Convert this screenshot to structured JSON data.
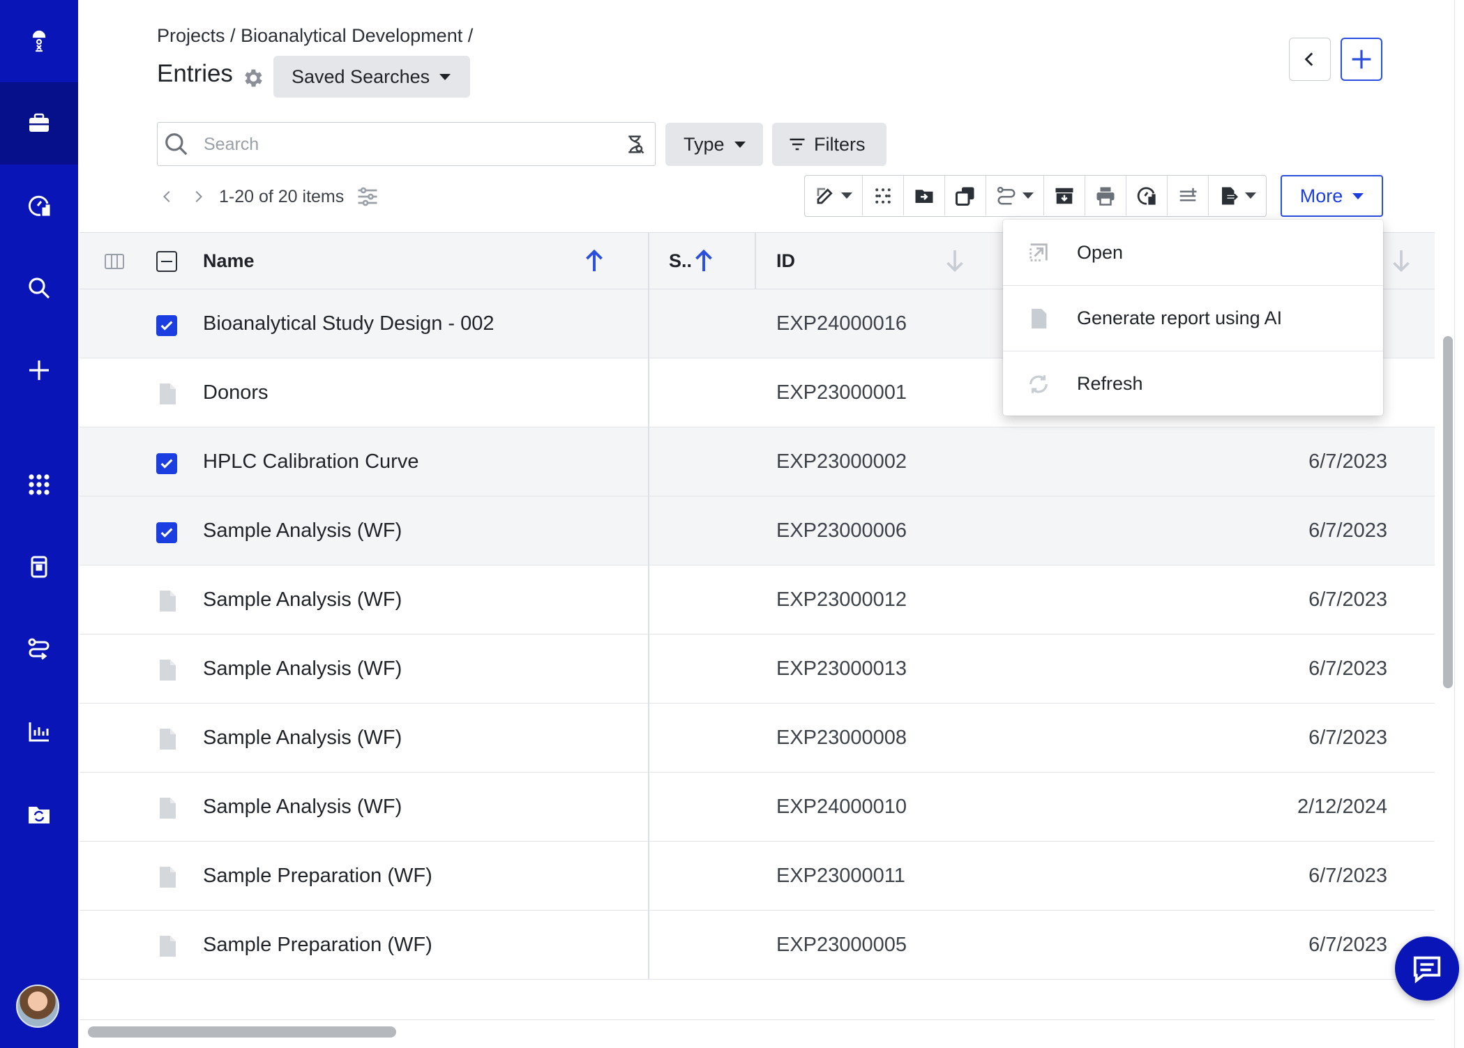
{
  "sidebar": {
    "items": [
      {
        "name": "logo-icon"
      },
      {
        "name": "projects-briefcase-icon"
      },
      {
        "name": "dashboard-gauge-icon"
      },
      {
        "name": "search-icon"
      },
      {
        "name": "create-plus-icon"
      },
      {
        "name": "apps-grid-icon"
      },
      {
        "name": "inventory-icon"
      },
      {
        "name": "workflows-icon"
      },
      {
        "name": "reports-chart-icon"
      },
      {
        "name": "sync-folder-icon"
      }
    ]
  },
  "header": {
    "breadcrumb": "Projects / Bioanalytical Development /",
    "title": "Entries",
    "saved_searches_label": "Saved Searches"
  },
  "search": {
    "placeholder": "Search",
    "value": ""
  },
  "filters": {
    "type_label": "Type",
    "filters_label": "Filters"
  },
  "paging": {
    "count_label": "1-20 of 20 items"
  },
  "toolbar": {
    "more_label": "More"
  },
  "table": {
    "columns": {
      "name": "Name",
      "status": "S..",
      "id": "ID"
    },
    "rows": [
      {
        "name": "Bioanalytical Study Design - 002",
        "id": "EXP24000016",
        "date": "",
        "selected": true
      },
      {
        "name": "Donors",
        "id": "EXP23000001",
        "date": "",
        "selected": false
      },
      {
        "name": "HPLC Calibration Curve",
        "id": "EXP23000002",
        "date": "6/7/2023",
        "selected": true
      },
      {
        "name": "Sample Analysis (WF)",
        "id": "EXP23000006",
        "date": "6/7/2023",
        "selected": true
      },
      {
        "name": "Sample Analysis (WF)",
        "id": "EXP23000012",
        "date": "6/7/2023",
        "selected": false
      },
      {
        "name": "Sample Analysis (WF)",
        "id": "EXP23000013",
        "date": "6/7/2023",
        "selected": false
      },
      {
        "name": "Sample Analysis (WF)",
        "id": "EXP23000008",
        "date": "6/7/2023",
        "selected": false
      },
      {
        "name": "Sample Analysis (WF)",
        "id": "EXP24000010",
        "date": "2/12/2024",
        "selected": false
      },
      {
        "name": "Sample Preparation (WF)",
        "id": "EXP23000011",
        "date": "6/7/2023",
        "selected": false
      },
      {
        "name": "Sample Preparation (WF)",
        "id": "EXP23000005",
        "date": "6/7/2023",
        "selected": false
      }
    ]
  },
  "more_menu": {
    "items": [
      "Open",
      "Generate report using AI",
      "Refresh"
    ]
  },
  "colors": {
    "sidebar": "#0a15b8",
    "accent": "#1a3ee0",
    "row_selected": "#f4f5f7"
  }
}
